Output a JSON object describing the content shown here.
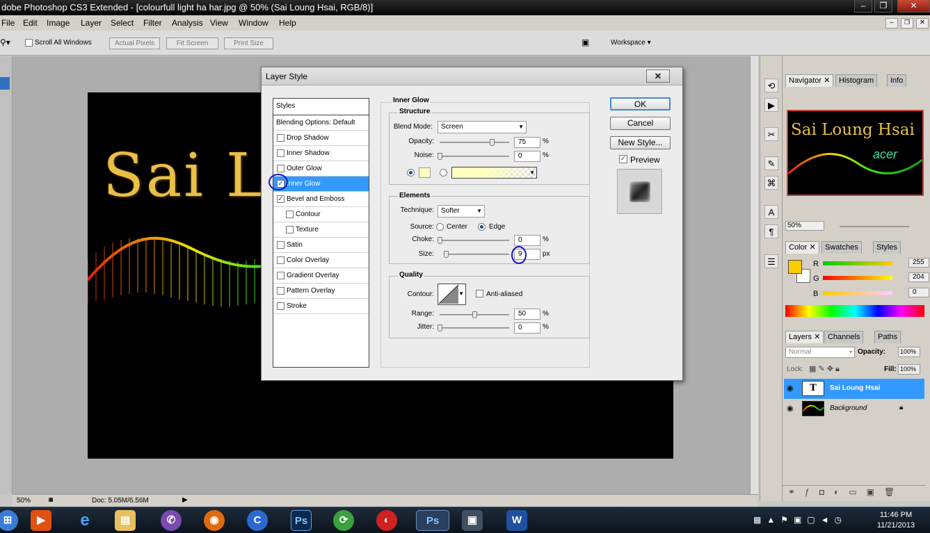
{
  "window": {
    "title": "dobe Photoshop CS3 Extended - [colourfull light ha har.jpg @ 50% (Sai Loung Hsai, RGB/8)]"
  },
  "menu": [
    "File",
    "Edit",
    "Image",
    "Layer",
    "Select",
    "Filter",
    "Analysis",
    "View",
    "Window",
    "Help"
  ],
  "options": {
    "scroll_all": "Scroll All Windows",
    "actual_pixels": "Actual Pixels",
    "fit_screen": "Fit Screen",
    "print_size": "Print Size",
    "workspace": "Workspace"
  },
  "document": {
    "text": "Sai L"
  },
  "status": {
    "zoom": "50%",
    "doc": "Doc: 5.05M/6.56M"
  },
  "dialog": {
    "title": "Layer Style",
    "styles_header": "Styles",
    "blending": "Blending Options: Default",
    "items": [
      {
        "label": "Drop Shadow",
        "checked": false,
        "indent": false,
        "selected": false
      },
      {
        "label": "Inner Shadow",
        "checked": false,
        "indent": false,
        "selected": false
      },
      {
        "label": "Outer Glow",
        "checked": false,
        "indent": false,
        "selected": false
      },
      {
        "label": "Inner Glow",
        "checked": true,
        "indent": false,
        "selected": true
      },
      {
        "label": "Bevel and Emboss",
        "checked": true,
        "indent": false,
        "selected": false
      },
      {
        "label": "Contour",
        "checked": false,
        "indent": true,
        "selected": false
      },
      {
        "label": "Texture",
        "checked": false,
        "indent": true,
        "selected": false
      },
      {
        "label": "Satin",
        "checked": false,
        "indent": false,
        "selected": false
      },
      {
        "label": "Color Overlay",
        "checked": false,
        "indent": false,
        "selected": false
      },
      {
        "label": "Gradient Overlay",
        "checked": false,
        "indent": false,
        "selected": false
      },
      {
        "label": "Pattern Overlay",
        "checked": false,
        "indent": false,
        "selected": false
      },
      {
        "label": "Stroke",
        "checked": false,
        "indent": false,
        "selected": false
      }
    ],
    "section_title": "Inner Glow",
    "structure": {
      "title": "Structure",
      "blend_mode_label": "Blend Mode:",
      "blend_mode": "Screen",
      "opacity_label": "Opacity:",
      "opacity": "75",
      "noise_label": "Noise:",
      "noise": "0",
      "percent": "%",
      "opacity_frac": 0.75,
      "noise_frac": 0.0
    },
    "elements": {
      "title": "Elements",
      "technique_label": "Technique:",
      "technique": "Softer",
      "source_label": "Source:",
      "center": "Center",
      "edge": "Edge",
      "choke_label": "Choke:",
      "choke": "0",
      "size_label": "Size:",
      "size": "9",
      "px": "px",
      "size_frac": 0.036
    },
    "quality": {
      "title": "Quality",
      "contour_label": "Contour:",
      "anti_aliased": "Anti-aliased",
      "range_label": "Range:",
      "range": "50",
      "jitter_label": "Jitter:",
      "jitter": "0",
      "range_frac": 0.5
    },
    "buttons": {
      "ok": "OK",
      "cancel": "Cancel",
      "new_style": "New Style...",
      "preview": "Preview"
    }
  },
  "navigator": {
    "tabs": [
      "Navigator",
      "Histogram",
      "Info"
    ],
    "thumb_text": "Sai Loung Hsai",
    "thumb_sub": "acer",
    "zoom": "50%"
  },
  "color": {
    "tabs": [
      "Color",
      "Swatches",
      "Styles"
    ],
    "r_label": "R",
    "g_label": "G",
    "b_label": "B",
    "r": "255",
    "g": "204",
    "b": "0",
    "fg": "#ffcc00"
  },
  "layers": {
    "tabs": [
      "Layers",
      "Channels",
      "Paths"
    ],
    "blend": "Normal",
    "opacity_label": "Opacity:",
    "opacity": "100%",
    "lock_label": "Lock:",
    "fill_label": "Fill:",
    "fill": "100%",
    "rows": [
      {
        "name": "Sai Loung Hsai",
        "thumb": "T",
        "selected": true
      },
      {
        "name": "Background",
        "thumb": "",
        "selected": false
      }
    ]
  },
  "taskbar": {
    "time": "11:46 PM",
    "date": "11/21/2013"
  }
}
